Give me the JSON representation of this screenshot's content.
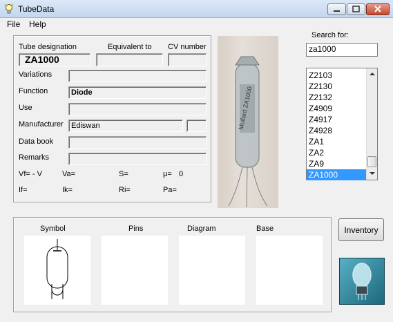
{
  "window": {
    "title": "TubeData"
  },
  "menu": {
    "file": "File",
    "help": "Help"
  },
  "tube": {
    "designation_label": "Tube designation",
    "equivalent_label": "Equivalent to",
    "cv_label": "CV number",
    "designation": "ZA1000",
    "equivalent": "",
    "cv_number": "",
    "variations_label": "Variations",
    "variations": "",
    "function_label": "Function",
    "function": "Diode",
    "use_label": "Use",
    "use": "",
    "manufacturer_label": "Manufacturer",
    "manufacturer": "Ediswan",
    "manufacturer_extra": "",
    "databook_label": "Data book",
    "databook": "",
    "remarks_label": "Remarks",
    "remarks": ""
  },
  "parameters": {
    "vf": "Vf= -  V",
    "va": "Va=",
    "s": "S=",
    "mu_label": "µ=",
    "mu": "0",
    "if": "If=",
    "ik": "Ik=",
    "ri": "Ri=",
    "pa": "Pa="
  },
  "search": {
    "label": "Search for:",
    "value": "za1000",
    "results": [
      "Z2103",
      "Z2130",
      "Z2132",
      "Z4909",
      "Z4917",
      "Z4928",
      "ZA1",
      "ZA2",
      "ZA9",
      "ZA1000"
    ],
    "selected": "ZA1000"
  },
  "bottom": {
    "symbol_label": "Symbol",
    "pins_label": "Pins",
    "diagram_label": "Diagram",
    "base_label": "Base"
  },
  "buttons": {
    "inventory": "Inventory"
  },
  "photo": {
    "tube_text": "Mullard ZA1000"
  },
  "colors": {
    "selection": "#3399ff",
    "window_bg": "#f0f0f0"
  }
}
